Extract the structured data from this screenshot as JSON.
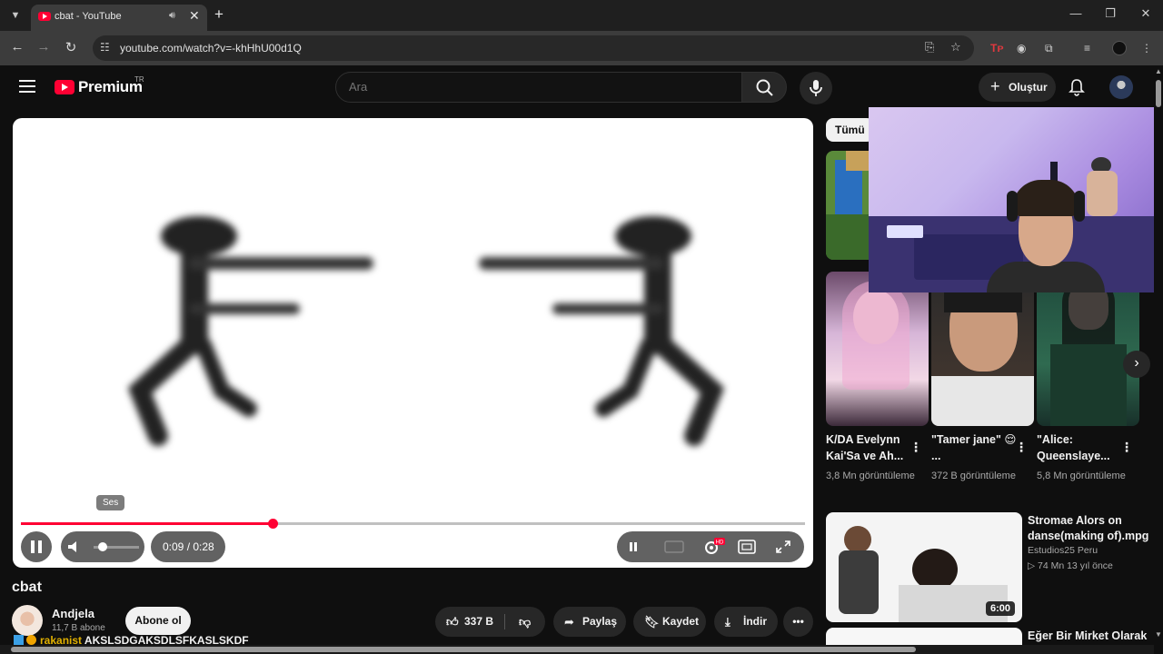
{
  "browser": {
    "tab_title": "cbat - YouTube",
    "url": "youtube.com/watch?v=-khHhU00d1Q"
  },
  "header": {
    "logo_text": "Premium",
    "country": "TR",
    "search_placeholder": "Ara",
    "create_label": "Oluştur"
  },
  "player": {
    "tooltip": "Ses",
    "time": "0:09 / 0:28",
    "progress": 0.3214,
    "volume": 0.1,
    "colors": {
      "progress": "#ff0033"
    }
  },
  "video": {
    "title": "cbat",
    "channel": "Andjela",
    "subscribers": "11,7 B abone",
    "subscribe_label": "Abone ol",
    "likes": "337 B",
    "share_label": "Paylaş",
    "save_label": "Kaydet",
    "download_label": "İndir"
  },
  "chat": {
    "user": "rakanist",
    "message": "AKSLSDGAKSDLSFKASLSKDF"
  },
  "sidebar": {
    "chip": "Tümü",
    "shorts": [
      {
        "title": "K/DA Evelynn Kai'Sa ve Ah...",
        "views": "3,8 Mn görüntüleme"
      },
      {
        "title": "\"Tamer jane\" 😌 ...",
        "views": "372 B görüntüleme"
      },
      {
        "title": "\"Alice: Queenslaye...",
        "views": "5,8 Mn görüntüleme"
      }
    ],
    "recommended": {
      "title": "Stromae   Alors on danse(making of).mpg",
      "channel": "Estudios25 Peru",
      "meta": "▷ 74 Mn   13 yıl önce",
      "duration": "6:00"
    },
    "next_title": "Eğer Bir Mirket Olarak"
  }
}
